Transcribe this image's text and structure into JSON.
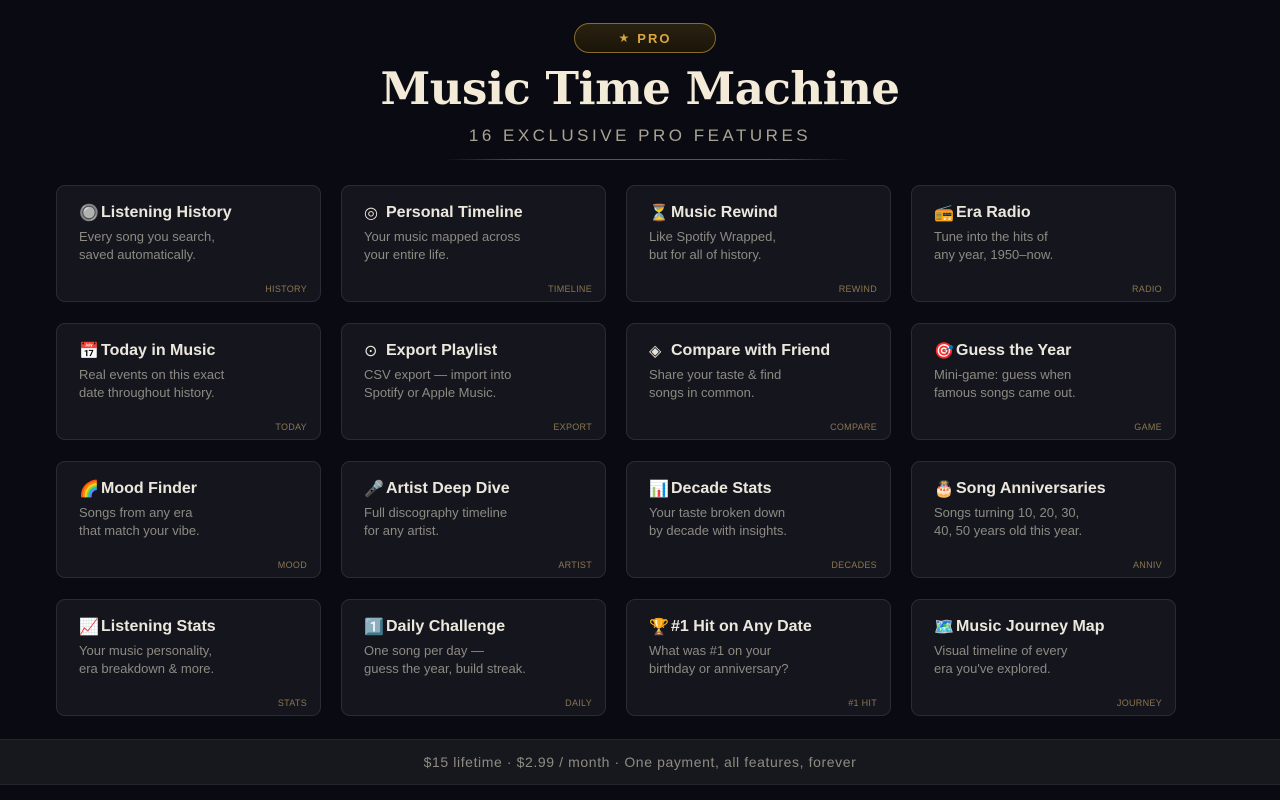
{
  "header": {
    "badge_star": "★",
    "badge_label": "PRO",
    "title": "Music Time Machine",
    "subtitle": "16 EXCLUSIVE PRO FEATURES"
  },
  "colors": {
    "background": "#0a0b12",
    "accent_gold": "#d9a640",
    "card_bg": "#14151d"
  },
  "features": [
    {
      "icon": "🔘",
      "icon_name": "target-dot-icon",
      "name": "Listening History",
      "desc1": "Every song you search,",
      "desc2": "saved automatically.",
      "tag": "HISTORY"
    },
    {
      "icon": "◎",
      "icon_name": "concentric-circle-icon",
      "name": "Personal Timeline",
      "desc1": "Your music mapped across",
      "desc2": "your entire life.",
      "tag": "TIMELINE"
    },
    {
      "icon": "⏳",
      "icon_name": "hourglass-icon",
      "name": "Music Rewind",
      "desc1": "Like Spotify Wrapped,",
      "desc2": "but for all of history.",
      "tag": "REWIND"
    },
    {
      "icon": "📻",
      "icon_name": "radio-icon",
      "name": "Era Radio",
      "desc1": "Tune into the hits of",
      "desc2": "any year, 1950–now.",
      "tag": "RADIO"
    },
    {
      "icon": "📅",
      "icon_name": "calendar-icon",
      "name": "Today in Music",
      "desc1": "Real events on this exact",
      "desc2": "date throughout history.",
      "tag": "TODAY"
    },
    {
      "icon": "⊙",
      "icon_name": "circle-dot-icon",
      "name": "Export Playlist",
      "desc1": "CSV export — import into",
      "desc2": "Spotify or Apple Music.",
      "tag": "EXPORT"
    },
    {
      "icon": "◈",
      "icon_name": "diamond-icon",
      "name": "Compare with Friend",
      "desc1": "Share your taste & find",
      "desc2": "songs in common.",
      "tag": "COMPARE"
    },
    {
      "icon": "🎯",
      "icon_name": "dart-target-icon",
      "name": "Guess the Year",
      "desc1": "Mini-game: guess when",
      "desc2": "famous songs came out.",
      "tag": "GAME"
    },
    {
      "icon": "🌈",
      "icon_name": "rainbow-icon",
      "name": "Mood Finder",
      "desc1": "Songs from any era",
      "desc2": "that match your vibe.",
      "tag": "MOOD"
    },
    {
      "icon": "🎤",
      "icon_name": "microphone-icon",
      "name": "Artist Deep Dive",
      "desc1": "Full discography timeline",
      "desc2": "for any artist.",
      "tag": "ARTIST"
    },
    {
      "icon": "📊",
      "icon_name": "bar-chart-icon",
      "name": "Decade Stats",
      "desc1": "Your taste broken down",
      "desc2": "by decade with insights.",
      "tag": "DECADES"
    },
    {
      "icon": "🎂",
      "icon_name": "birthday-cake-icon",
      "name": "Song Anniversaries",
      "desc1": "Songs turning 10, 20, 30,",
      "desc2": "40, 50 years old this year.",
      "tag": "ANNIV"
    },
    {
      "icon": "📈",
      "icon_name": "trending-chart-icon",
      "name": "Listening Stats",
      "desc1": "Your music personality,",
      "desc2": "era breakdown & more.",
      "tag": "STATS"
    },
    {
      "icon": "1️⃣",
      "icon_name": "number-one-icon",
      "name": "Daily Challenge",
      "desc1": "One song per day —",
      "desc2": "guess the year, build streak.",
      "tag": "DAILY"
    },
    {
      "icon": "🏆",
      "icon_name": "trophy-icon",
      "name": "#1 Hit on Any Date",
      "desc1": "What was #1 on your",
      "desc2": "birthday or anniversary?",
      "tag": "#1 HIT"
    },
    {
      "icon": "🗺️",
      "icon_name": "world-map-icon",
      "name": "Music Journey Map",
      "desc1": "Visual timeline of every",
      "desc2": "era you've explored.",
      "tag": "JOURNEY"
    }
  ],
  "footer": {
    "text": "$15 lifetime · $2.99 / month · One payment, all features, forever"
  }
}
